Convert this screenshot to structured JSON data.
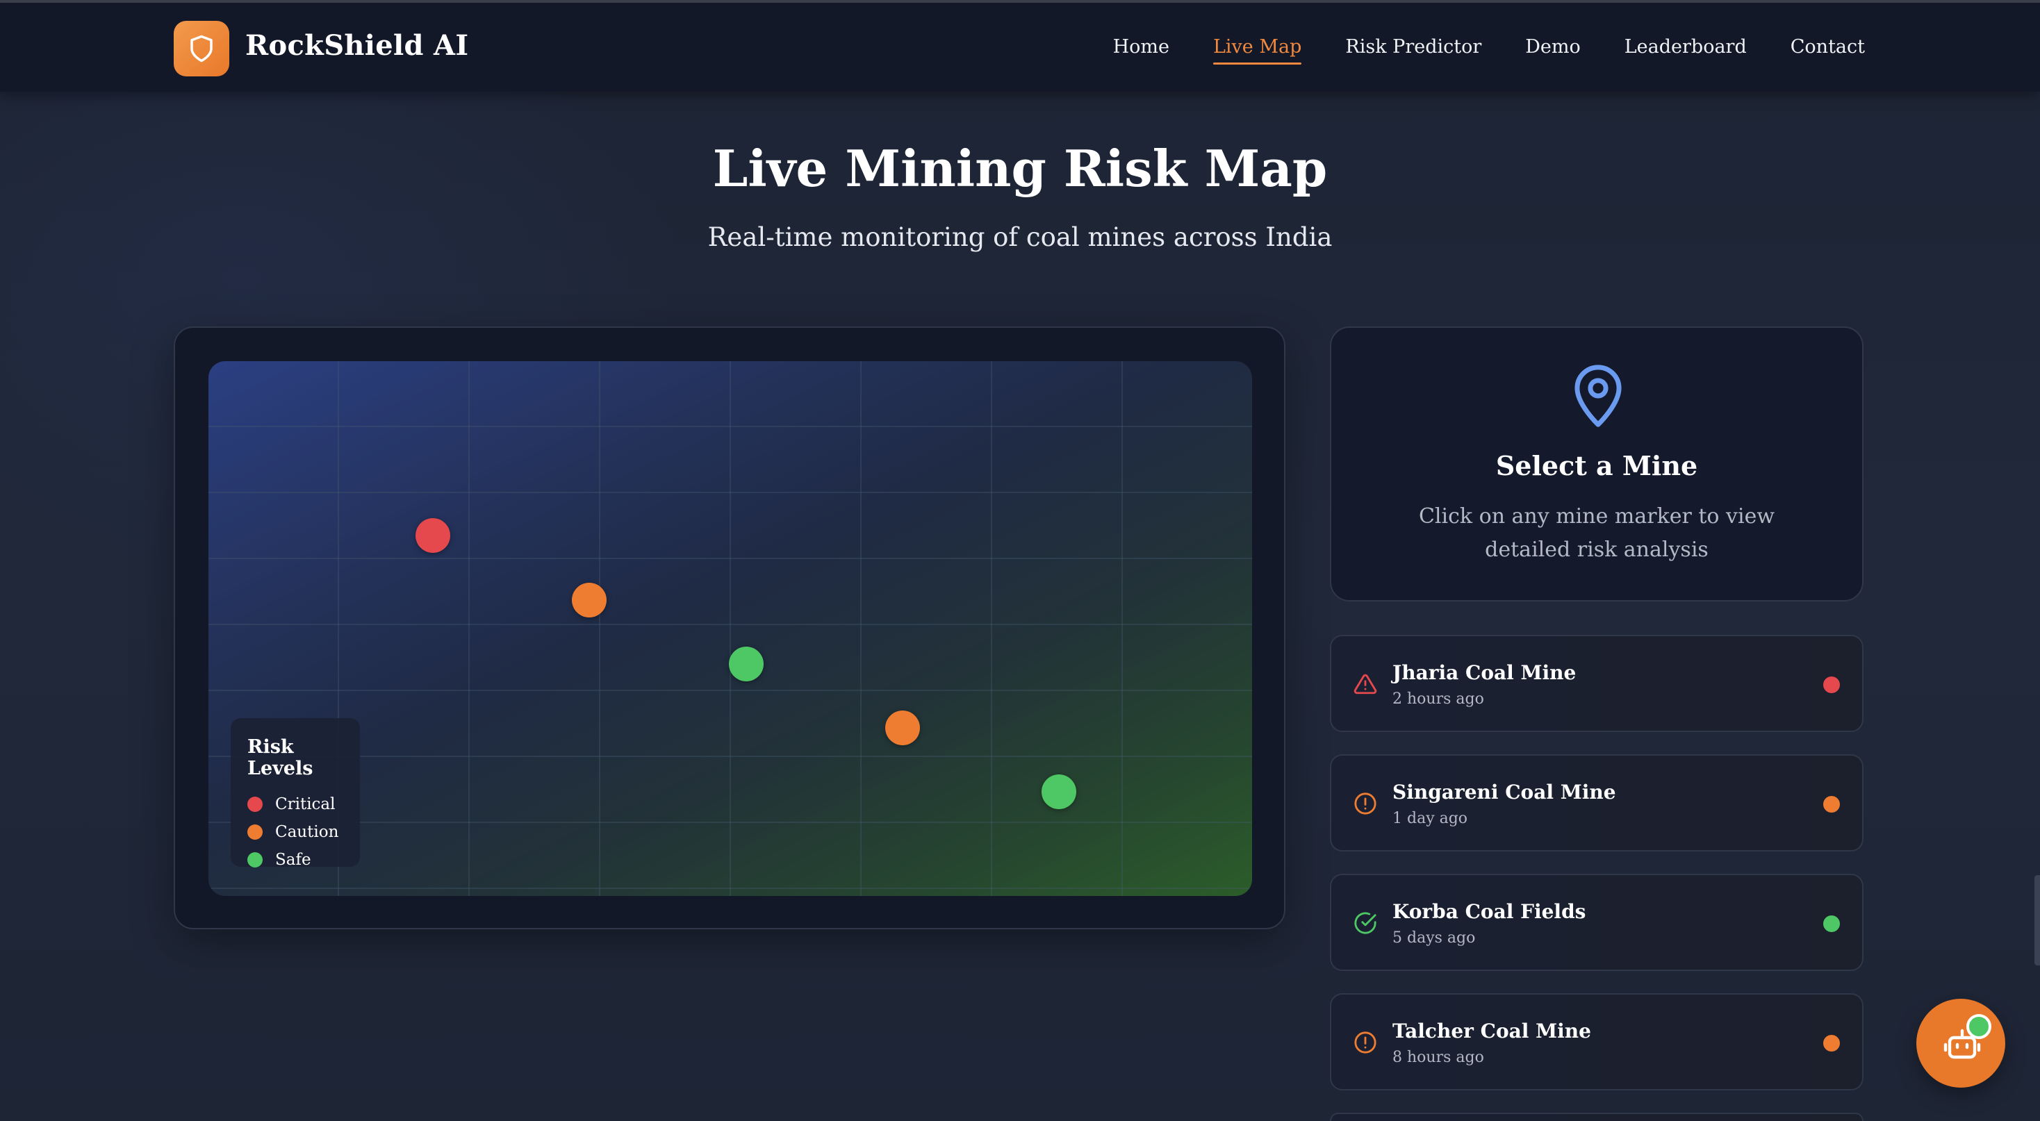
{
  "brand": {
    "name": "RockShield AI",
    "icon": "shield-icon",
    "color": "#e8782a"
  },
  "nav": {
    "items": [
      {
        "label": "Home",
        "active": false
      },
      {
        "label": "Live Map",
        "active": true
      },
      {
        "label": "Risk Predictor",
        "active": false
      },
      {
        "label": "Demo",
        "active": false
      },
      {
        "label": "Leaderboard",
        "active": false
      },
      {
        "label": "Contact",
        "active": false
      }
    ],
    "active_color": "#f0883e"
  },
  "header": {
    "title": "Live Mining Risk Map",
    "subtitle": "Real-time monitoring of coal mines across India"
  },
  "map": {
    "markers": [
      {
        "status": "critical",
        "color": "#e5484d"
      },
      {
        "status": "caution",
        "color": "#ee7d32"
      },
      {
        "status": "safe",
        "color": "#4ec865"
      },
      {
        "status": "caution",
        "color": "#ee7d32"
      },
      {
        "status": "safe",
        "color": "#4ec865"
      }
    ],
    "legend": {
      "title": "Risk Levels",
      "items": [
        {
          "label": "Critical",
          "color": "#e5484d"
        },
        {
          "label": "Caution",
          "color": "#ee7d32"
        },
        {
          "label": "Safe",
          "color": "#4ec865"
        }
      ]
    }
  },
  "select_panel": {
    "icon": "map-pin-icon",
    "title": "Select a Mine",
    "description": "Click on any mine marker to view detailed risk analysis"
  },
  "mines": [
    {
      "name": "Jharia Coal Mine",
      "time": "2 hours ago",
      "status": "critical",
      "icon": "warning-triangle-icon",
      "color": "#e5484d"
    },
    {
      "name": "Singareni Coal Mine",
      "time": "1 day ago",
      "status": "caution",
      "icon": "alert-circle-icon",
      "color": "#ee7d32"
    },
    {
      "name": "Korba Coal Fields",
      "time": "5 days ago",
      "status": "safe",
      "icon": "check-circle-icon",
      "color": "#4ec865"
    },
    {
      "name": "Talcher Coal Mine",
      "time": "8 hours ago",
      "status": "caution",
      "icon": "alert-circle-icon",
      "color": "#ee7d32"
    }
  ],
  "chat": {
    "icon": "robot-icon"
  }
}
